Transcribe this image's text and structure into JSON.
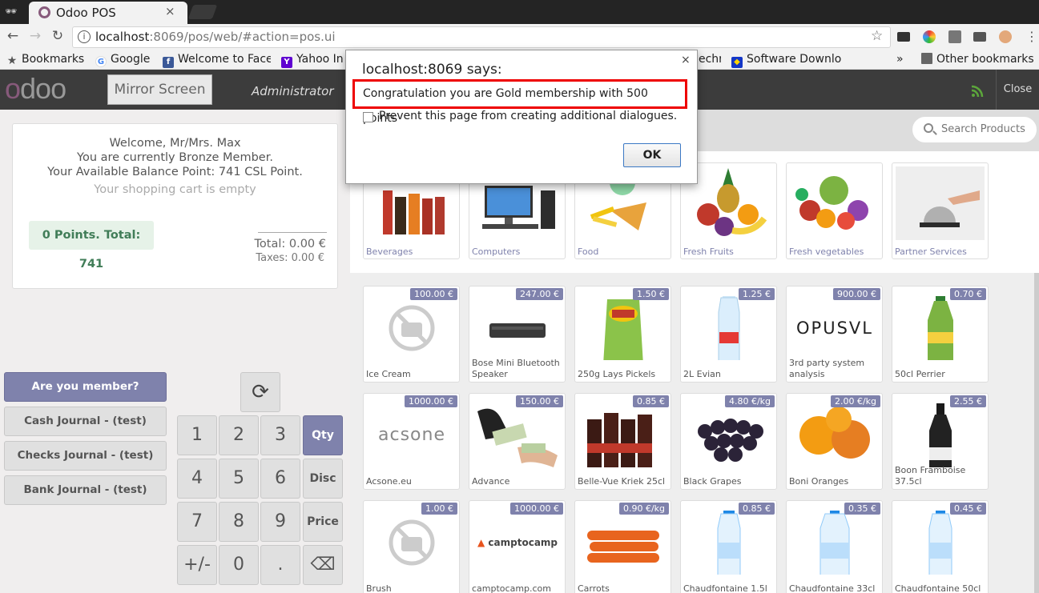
{
  "browser": {
    "tab_title": "Odoo POS",
    "tab_close": "×",
    "url_host": "localhost",
    "url_rest": ":8069/pos/web/#action=pos.ui",
    "bookmarks": [
      {
        "label": "Bookmarks",
        "icon": "star-icon"
      },
      {
        "label": "Google",
        "icon": "google-icon"
      },
      {
        "label": "Welcome to Face",
        "icon": "facebook-icon"
      },
      {
        "label": "Yahoo In",
        "icon": "yahoo-icon"
      },
      {
        "label": "echr",
        "icon": "none"
      },
      {
        "label": "Software Downlo",
        "icon": "software-icon"
      },
      {
        "label": "»",
        "icon": "none"
      },
      {
        "label": "Other bookmarks",
        "icon": "folder-icon"
      }
    ]
  },
  "pos_header": {
    "mirror_label": "Mirror Screen",
    "user": "Administrator",
    "close_label": "Close"
  },
  "order": {
    "welcome": "Welcome, Mr/Mrs. Max",
    "membership": "You are currently Bronze Member.",
    "balance": "Your Available Balance Point: 741 CSL Point.",
    "empty": "Your shopping cart is empty",
    "points": "0 Points. Total: 741",
    "total": "Total: 0.00 €",
    "taxes": "Taxes: 0.00 €"
  },
  "payment": {
    "member": "Are you member?",
    "cash": "Cash Journal - (test)",
    "checks": "Checks Journal - (test)",
    "bank": "Bank Journal - (test)"
  },
  "numpad": {
    "k1": "1",
    "k2": "2",
    "k3": "3",
    "qty": "Qty",
    "k4": "4",
    "k5": "5",
    "k6": "6",
    "disc": "Disc",
    "k7": "7",
    "k8": "8",
    "k9": "9",
    "price": "Price",
    "sign": "+/-",
    "k0": "0",
    "dot": ".",
    "back": "⌫"
  },
  "search": {
    "placeholder": "Search Products"
  },
  "categories": [
    "Beverages",
    "Computers",
    "Food",
    "Fresh Fruits",
    "Fresh vegetables",
    "Partner Services"
  ],
  "products": [
    {
      "name": "Ice Cream",
      "price": "100.00 €"
    },
    {
      "name": "Bose Mini Bluetooth Speaker",
      "price": "247.00 €"
    },
    {
      "name": "250g Lays Pickels",
      "price": "1.50 €"
    },
    {
      "name": "2L Evian",
      "price": "1.25 €"
    },
    {
      "name": "3rd party system analysis",
      "price": "900.00 €",
      "logo": "OPUSVL"
    },
    {
      "name": "50cl Perrier",
      "price": "0.70 €"
    },
    {
      "name": "Acsone.eu",
      "price": "1000.00 €",
      "logo": "acsone"
    },
    {
      "name": "Advance",
      "price": "150.00 €"
    },
    {
      "name": "Belle-Vue Kriek 25cl",
      "price": "0.85 €"
    },
    {
      "name": "Black Grapes",
      "price": "4.80 €/kg"
    },
    {
      "name": "Boni Oranges",
      "price": "2.00 €/kg"
    },
    {
      "name": "Boon Framboise 37.5cl",
      "price": "2.55 €"
    },
    {
      "name": "Brush",
      "price": "1.00 €"
    },
    {
      "name": "camptocamp.com",
      "price": "1000.00 €",
      "logo": "camptocamp"
    },
    {
      "name": "Carrots",
      "price": "0.90 €/kg"
    },
    {
      "name": "Chaudfontaine 1.5l",
      "price": "0.85 €"
    },
    {
      "name": "Chaudfontaine 33cl",
      "price": "0.35 €"
    },
    {
      "name": "Chaudfontaine 50cl",
      "price": "0.45 €"
    }
  ],
  "dialog": {
    "title": "localhost:8069 says:",
    "message": "Congratulation you are Gold membership with 500 points",
    "checkbox_label": "Prevent this page from creating additional dialogues.",
    "ok": "OK",
    "close": "×"
  },
  "colors": {
    "accent": "#7f82ac",
    "header": "#3c3c3c",
    "highlight_border": "#e00000"
  }
}
